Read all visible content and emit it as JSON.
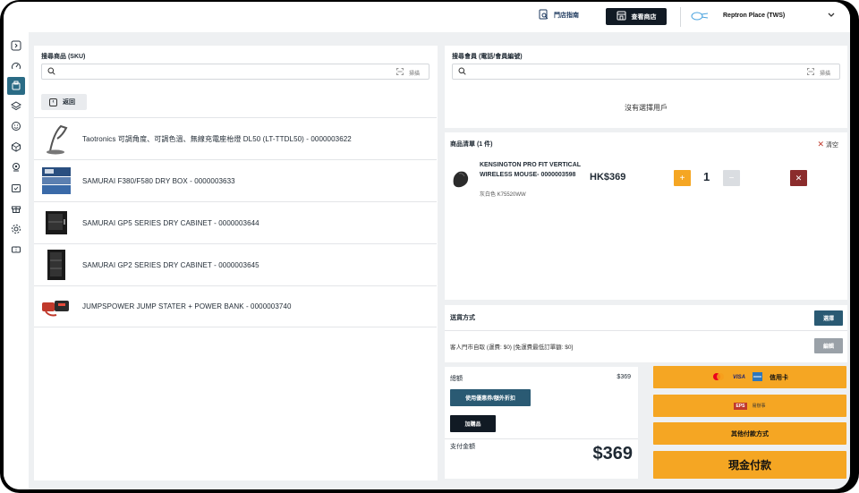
{
  "topbar": {
    "guide_label": "門店指南",
    "store_label": "查看商店",
    "place_name": "Reptron Place (TWS)"
  },
  "sidebar": {
    "icons": [
      "panel-toggle-icon",
      "dashboard-icon",
      "pos-icon",
      "layers-icon",
      "smiley-icon",
      "package-icon",
      "badge-icon",
      "calendar-icon",
      "gift-icon",
      "settings-icon",
      "ticket-icon"
    ]
  },
  "product_search": {
    "label": "搜尋商品 (SKU)",
    "scan_label": "掃描",
    "back_label": "返回",
    "products": [
      {
        "name": "Taotronics 可調角度、可調色溫、無線充電座枱燈 DL50 (LT-TTDL50) - 0000003622",
        "thumb": "lamp"
      },
      {
        "name": "SAMURAI F380/F580 DRY BOX - 0000003633",
        "thumb": "drybox"
      },
      {
        "name": "SAMURAI GP5 SERIES DRY CABINET - 0000003644",
        "thumb": "cabinet"
      },
      {
        "name": "SAMURAI GP2 SERIES DRY CABINET - 0000003645",
        "thumb": "cabinet-tall"
      },
      {
        "name": "JUMPSPOWER JUMP STATER + POWER BANK - 0000003740",
        "thumb": "jumpstarter"
      }
    ]
  },
  "member_search": {
    "label": "搜尋會員 (電話/會員編號)",
    "scan_label": "掃描",
    "empty_text": "沒有選擇用戶"
  },
  "cart": {
    "title": "商品清單 (1 件)",
    "clear_label": "清空",
    "item": {
      "name": "KENSINGTON PRO FIT VERTICAL WIRELESS MOUSE- 0000003598",
      "variant": "灰白色 K75520WW",
      "price": "HK$369",
      "qty": "1"
    }
  },
  "delivery": {
    "label": "送貨方式",
    "select_label": "選擇",
    "option_text": "客人門市自取 (運費: $0) [免運費最低訂單額: $0]",
    "edit_label": "編輯"
  },
  "summary": {
    "subtotal_label": "總額",
    "subtotal_value": "$369",
    "coupon_label": "使用優惠券/額外折扣",
    "addon_label": "加購品",
    "payable_label": "支付金額",
    "payable_value": "$369"
  },
  "payment": {
    "credit_card_label": "信用卡",
    "visa_label": "VISA",
    "eps_label": "EPS",
    "eps_text": "易辦事",
    "other_label": "其他付款方式",
    "cash_label": "現金付款"
  },
  "colors": {
    "accent_orange": "#f5a623",
    "dark_teal": "#2a5a73",
    "danger": "#8b2c2c",
    "active_sidebar": "#2a6b85"
  }
}
